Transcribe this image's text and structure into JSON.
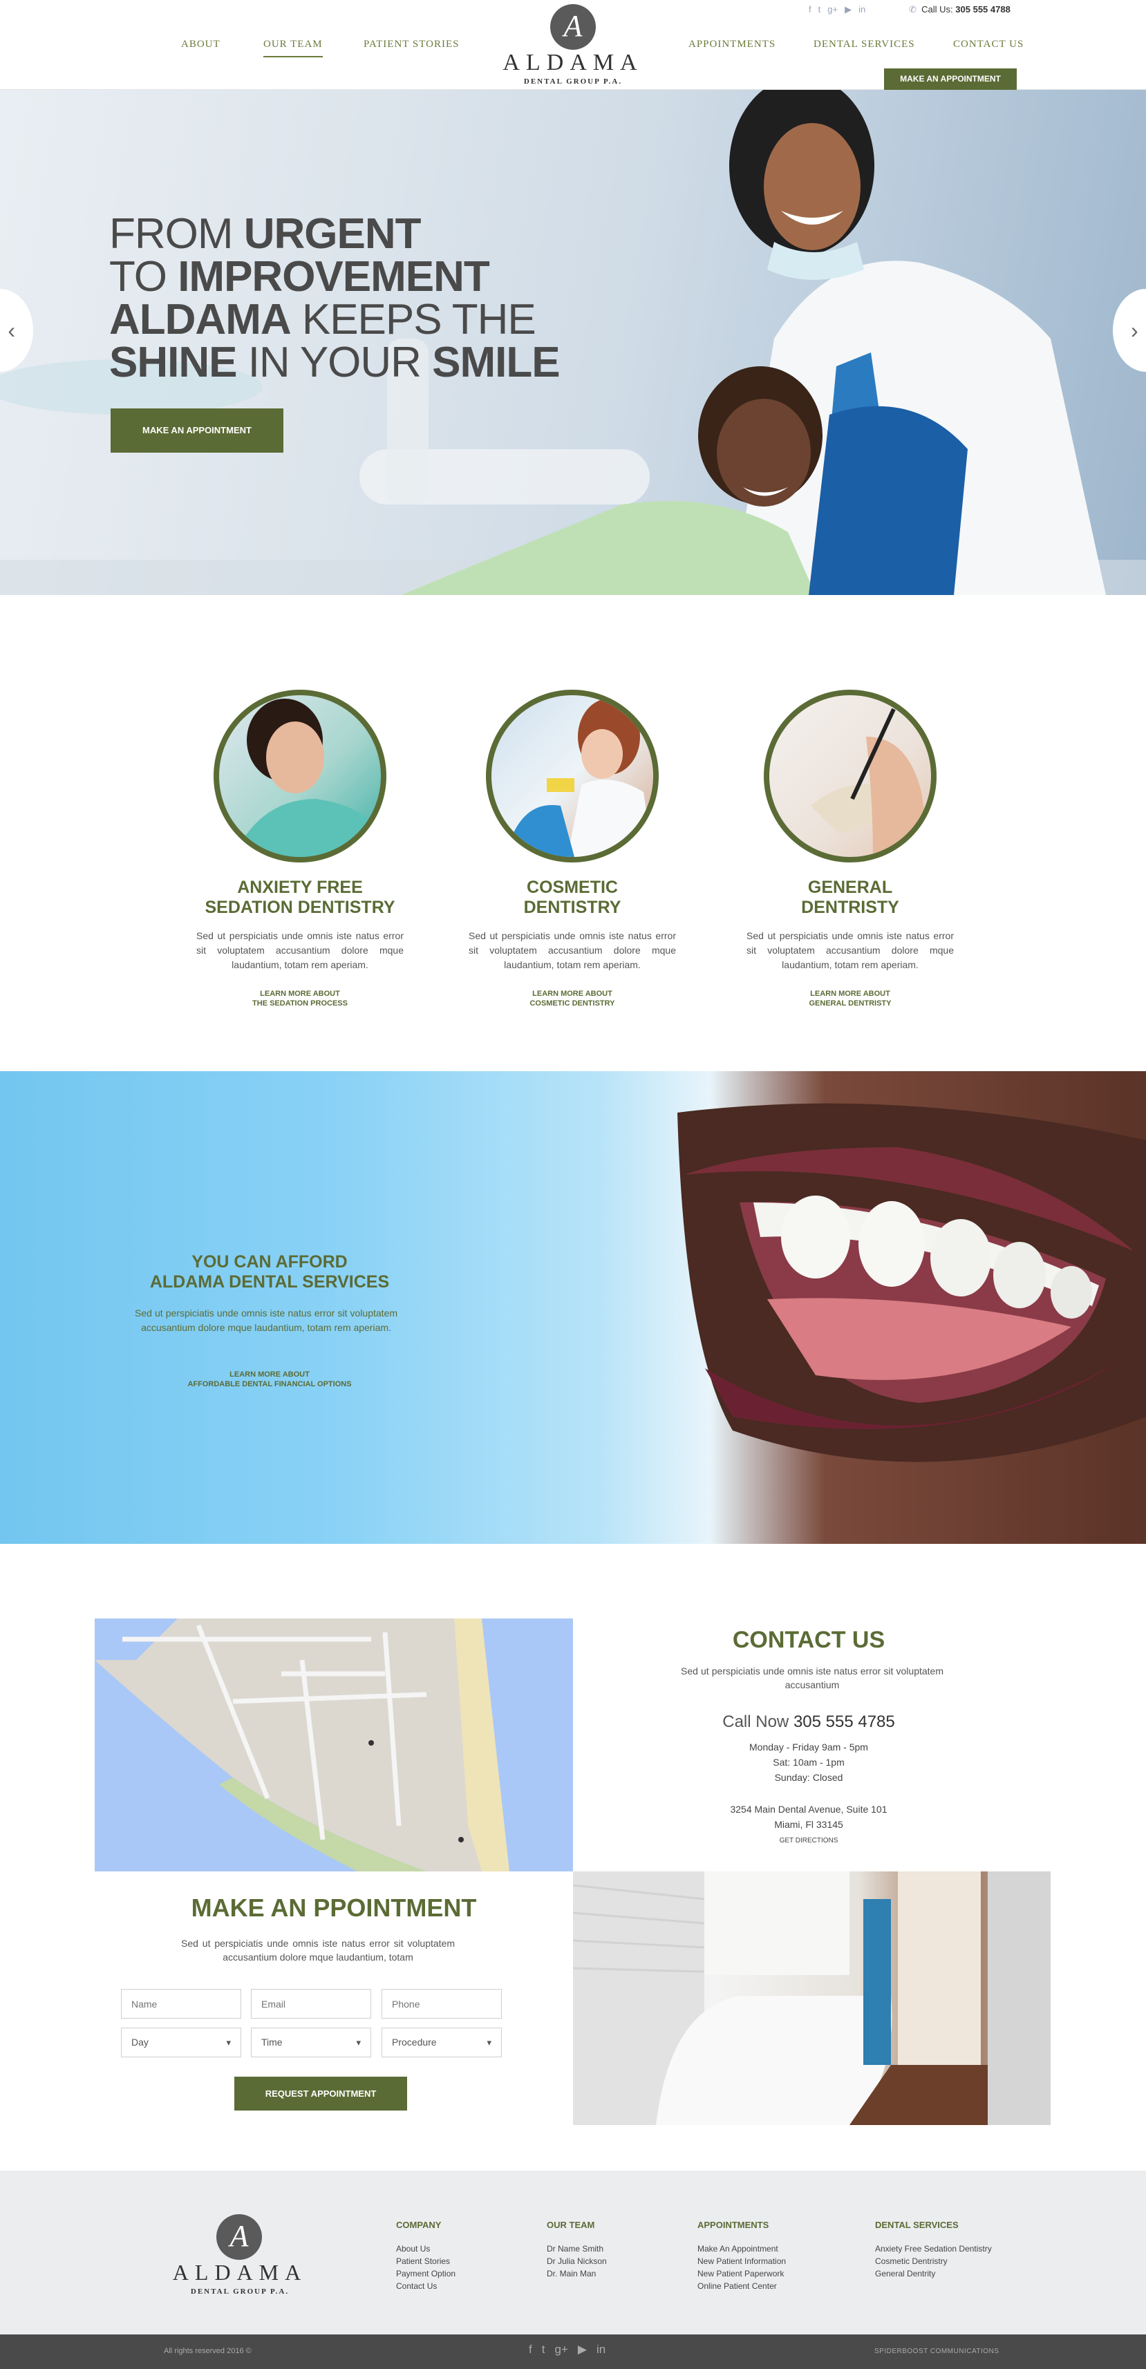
{
  "colors": {
    "brand_green": "#5b6b35",
    "footer_bg": "#ecedef",
    "bottom_bar": "#4a4a4a"
  },
  "header": {
    "nav_left": [
      "ABOUT",
      "OUR TEAM",
      "PATIENT STORIES"
    ],
    "nav_right": [
      "APPOINTMENTS",
      "DENTAL SERVICES",
      "CONTACT US"
    ],
    "active_nav": "OUR TEAM",
    "logo_letter": "A",
    "logo_name": "ALDAMA",
    "logo_sub": "DENTAL GROUP P.A.",
    "social_icons": [
      "facebook-icon",
      "twitter-icon",
      "google-plus-icon",
      "youtube-icon",
      "linkedin-icon"
    ],
    "call_label": "Call Us:",
    "phone": "305 555 4788",
    "cta": "MAKE AN APPOINTMENT"
  },
  "hero": {
    "line1_light": "FROM ",
    "line1_bold": "URGENT",
    "line2_light": "TO ",
    "line2_bold": "IMPROVEMENT",
    "line3_bold": "ALDAMA",
    "line3_light": " KEEPS THE",
    "line4_bold": "SHINE",
    "line4_light": " IN YOUR ",
    "line4_bold2": "SMILE",
    "cta": "MAKE AN APPOINTMENT",
    "prev_arrow": "‹",
    "next_arrow": "›"
  },
  "services": [
    {
      "title_1": "ANXIETY FREE",
      "title_2": "SEDATION DENTISTRY",
      "text": "Sed ut perspiciatis unde omnis iste natus error sit voluptatem accusantium dolore mque laudantium, totam rem aperiam.",
      "link_1": "LEARN MORE ABOUT",
      "link_2": "THE SEDATION PROCESS"
    },
    {
      "title_1": "COSMETIC",
      "title_2": "DENTISTRY",
      "text": "Sed ut perspiciatis unde omnis iste natus error sit voluptatem accusantium dolore mque laudantium, totam rem aperiam.",
      "link_1": "LEARN MORE ABOUT",
      "link_2": "COSMETIC DENTISTRY"
    },
    {
      "title_1": "GENERAL",
      "title_2": "DENTRISTY",
      "text": "Sed ut perspiciatis unde omnis iste natus error sit voluptatem accusantium dolore mque laudantium, totam rem aperiam.",
      "link_1": "LEARN MORE ABOUT",
      "link_2": "GENERAL DENTRISTY"
    }
  ],
  "afford": {
    "title_1": "YOU CAN AFFORD",
    "title_2": "ALDAMA DENTAL SERVICES",
    "text": "Sed ut perspiciatis unde omnis iste natus error sit voluptatem accusantium dolore mque laudantium, totam rem aperiam.",
    "link_1": "LEARN MORE ABOUT",
    "link_2": "AFFORDABLE DENTAL FINANCIAL OPTIONS"
  },
  "contact": {
    "title": "CONTACT US",
    "text": "Sed ut perspiciatis unde omnis iste natus error sit voluptatem accusantium",
    "call_label": "Call Now ",
    "phone": "305 555 4785",
    "hours_1": "Monday - Friday 9am - 5pm",
    "hours_2": "Sat: 10am - 1pm",
    "hours_3": "Sunday: Closed",
    "address_1": "3254 Main Dental Avenue, Suite 101",
    "address_2": "Miami, Fl 33145",
    "directions": "GET DIRECTIONS"
  },
  "appointment": {
    "title": "MAKE AN PPOINTMENT",
    "text": "Sed ut perspiciatis unde omnis iste natus error sit voluptatem accusantium dolore mque laudantium, totam",
    "name_placeholder": "Name",
    "email_placeholder": "Email",
    "phone_placeholder": "Phone",
    "day": "Day",
    "time": "Time",
    "procedure": "Procedure",
    "button": "REQUEST APPOINTMENT"
  },
  "footer": {
    "columns": [
      {
        "title": "COMPANY",
        "items": [
          "About Us",
          "Patient Stories",
          "Payment Option",
          "Contact Us"
        ]
      },
      {
        "title": "OUR TEAM",
        "items": [
          "Dr Name Smith",
          "Dr Julia Nickson",
          "Dr. Main Man"
        ]
      },
      {
        "title": "APPOINTMENTS",
        "items": [
          "Make An Appointment",
          "New Patient Information",
          "New Patient Paperwork",
          "Online Patient Center"
        ]
      },
      {
        "title": "DENTAL SERVICES",
        "items": [
          "Anxiety Free Sedation Dentistry",
          "Cosmetic Dentristry",
          "General Dentrity"
        ]
      }
    ],
    "copyright": "All rights reserved 2016 ©",
    "credit": "SPIDERBOOST COMMUNICATIONS"
  }
}
